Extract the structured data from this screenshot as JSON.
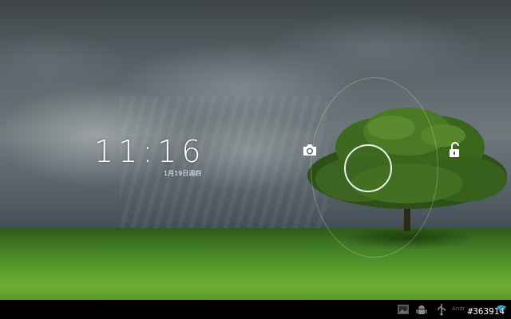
{
  "lockscreen": {
    "time": "11:16",
    "date": "1月19日週四"
  },
  "unlock_widget": {
    "left_target_icon": "camera-icon",
    "right_target_icon": "unlock-icon",
    "handle_icon": "unlock-handle-ring"
  },
  "status_bar": {
    "icons": [
      "gallery-icon",
      "android-icon",
      "usb-icon",
      "wifi-icon"
    ],
    "label": "Andr"
  },
  "overlay": {
    "screenshot_id": "#363914"
  },
  "colors": {
    "sky": "#5b6469",
    "grass": "#5a9a2c",
    "status_bar": "#000000",
    "clock_text": "#ffffff"
  }
}
